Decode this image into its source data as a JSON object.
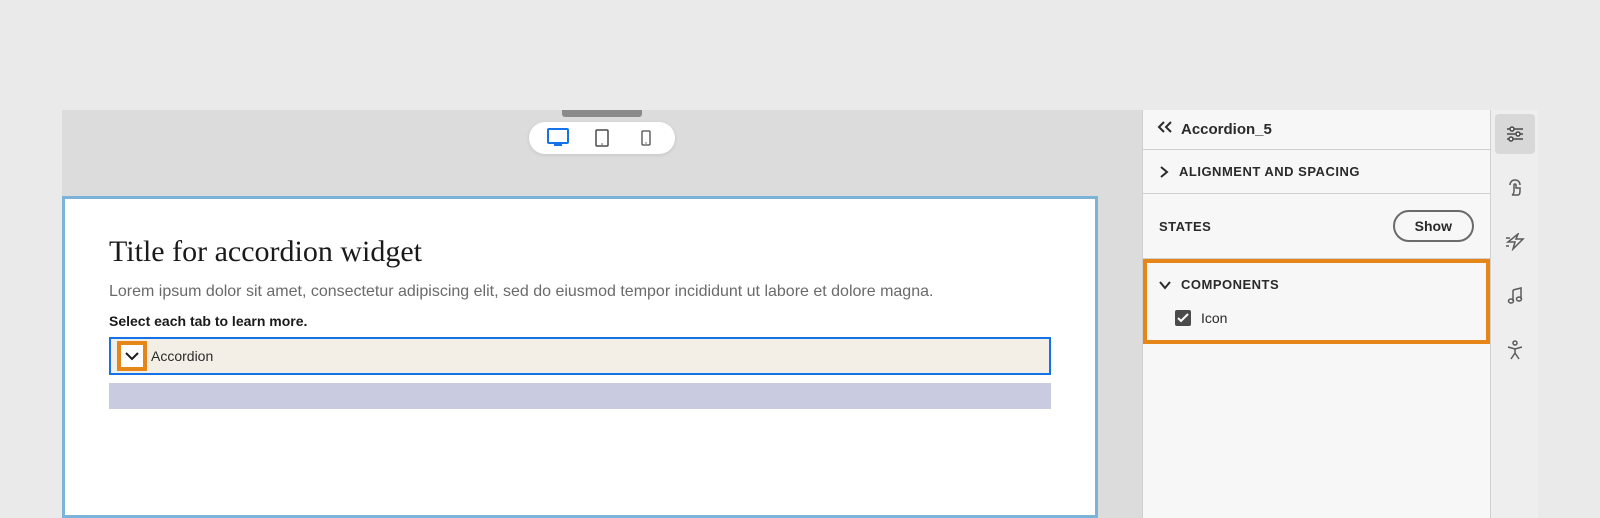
{
  "colors": {
    "accent_blue": "#1473e6",
    "highlight_orange": "#e68619",
    "card_border": "#7bb3d9"
  },
  "device_switcher": {
    "options": [
      "desktop",
      "tablet",
      "mobile"
    ],
    "active": "desktop"
  },
  "canvas": {
    "widget_title": "Title for accordion widget",
    "widget_description": "Lorem ipsum dolor sit amet, consectetur adipiscing elit, sed do eiusmod tempor incididunt ut labore et dolore magna.",
    "instruction": "Select each tab to learn more.",
    "accordion_item_label": "Accordion"
  },
  "properties": {
    "header_title": "Accordion_5",
    "sections": {
      "alignment": {
        "label": "ALIGNMENT AND SPACING",
        "expanded": false
      },
      "states": {
        "label": "STATES",
        "button_label": "Show"
      },
      "components": {
        "label": "COMPONENTS",
        "expanded": true,
        "items": [
          {
            "label": "Icon",
            "checked": true
          }
        ]
      }
    }
  },
  "right_rail_icons": [
    "settings",
    "touch",
    "lightning",
    "audio",
    "accessibility"
  ]
}
